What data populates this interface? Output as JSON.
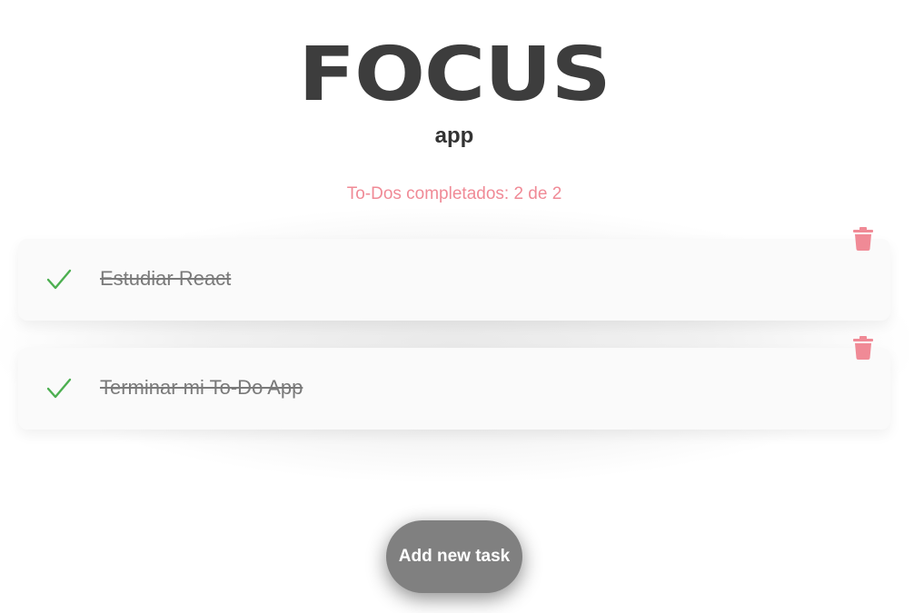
{
  "header": {
    "logo": "FOCUS",
    "subtitle": "app"
  },
  "counter": {
    "text": "To-Dos completados: 2 de 2"
  },
  "todos": [
    {
      "text": "Estudiar React",
      "completed": true,
      "check_icon": "check-icon",
      "delete_icon": "trash-icon"
    },
    {
      "text": "Terminar mi To-Do App",
      "completed": true,
      "check_icon": "check-icon",
      "delete_icon": "trash-icon"
    }
  ],
  "actions": {
    "add_label": "Add new task"
  },
  "colors": {
    "accent": "#f08a96",
    "check": "#4caf50",
    "button": "#808080",
    "logo": "#3d3d3d"
  }
}
